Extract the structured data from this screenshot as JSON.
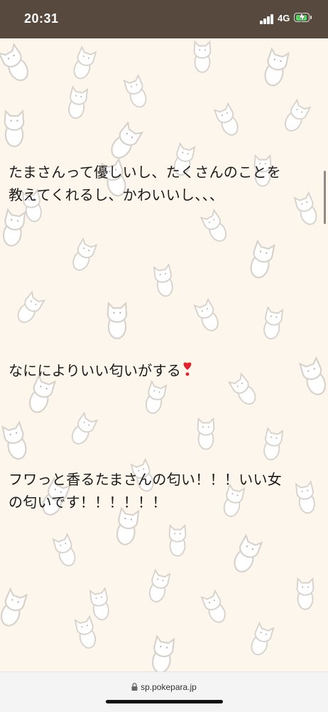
{
  "status_bar": {
    "time": "20:31",
    "network": "4G",
    "signal_icon": "cellular-signal-icon",
    "battery_icon": "battery-charging-icon",
    "battery_level": 0.8,
    "battery_color": "#4cd964"
  },
  "page": {
    "background_color": "#fdf6ec",
    "pattern_icon": "cat-pattern-icon",
    "messages": [
      {
        "lines": [
          "たまさんって優しいし、たくさんのことを",
          "教えてくれるし、かわいいし、、、"
        ]
      },
      {
        "lines": [
          "なにによりいい匂いがする"
        ],
        "emoji": "heart-exclamation-icon"
      },
      {
        "lines": [
          "フワっと香るたまさんの匂い！！！いい女",
          "の匂いです！！！！！！"
        ]
      }
    ]
  },
  "browser": {
    "url": "sp.pokepara.jp",
    "lock_icon": "lock-icon"
  }
}
